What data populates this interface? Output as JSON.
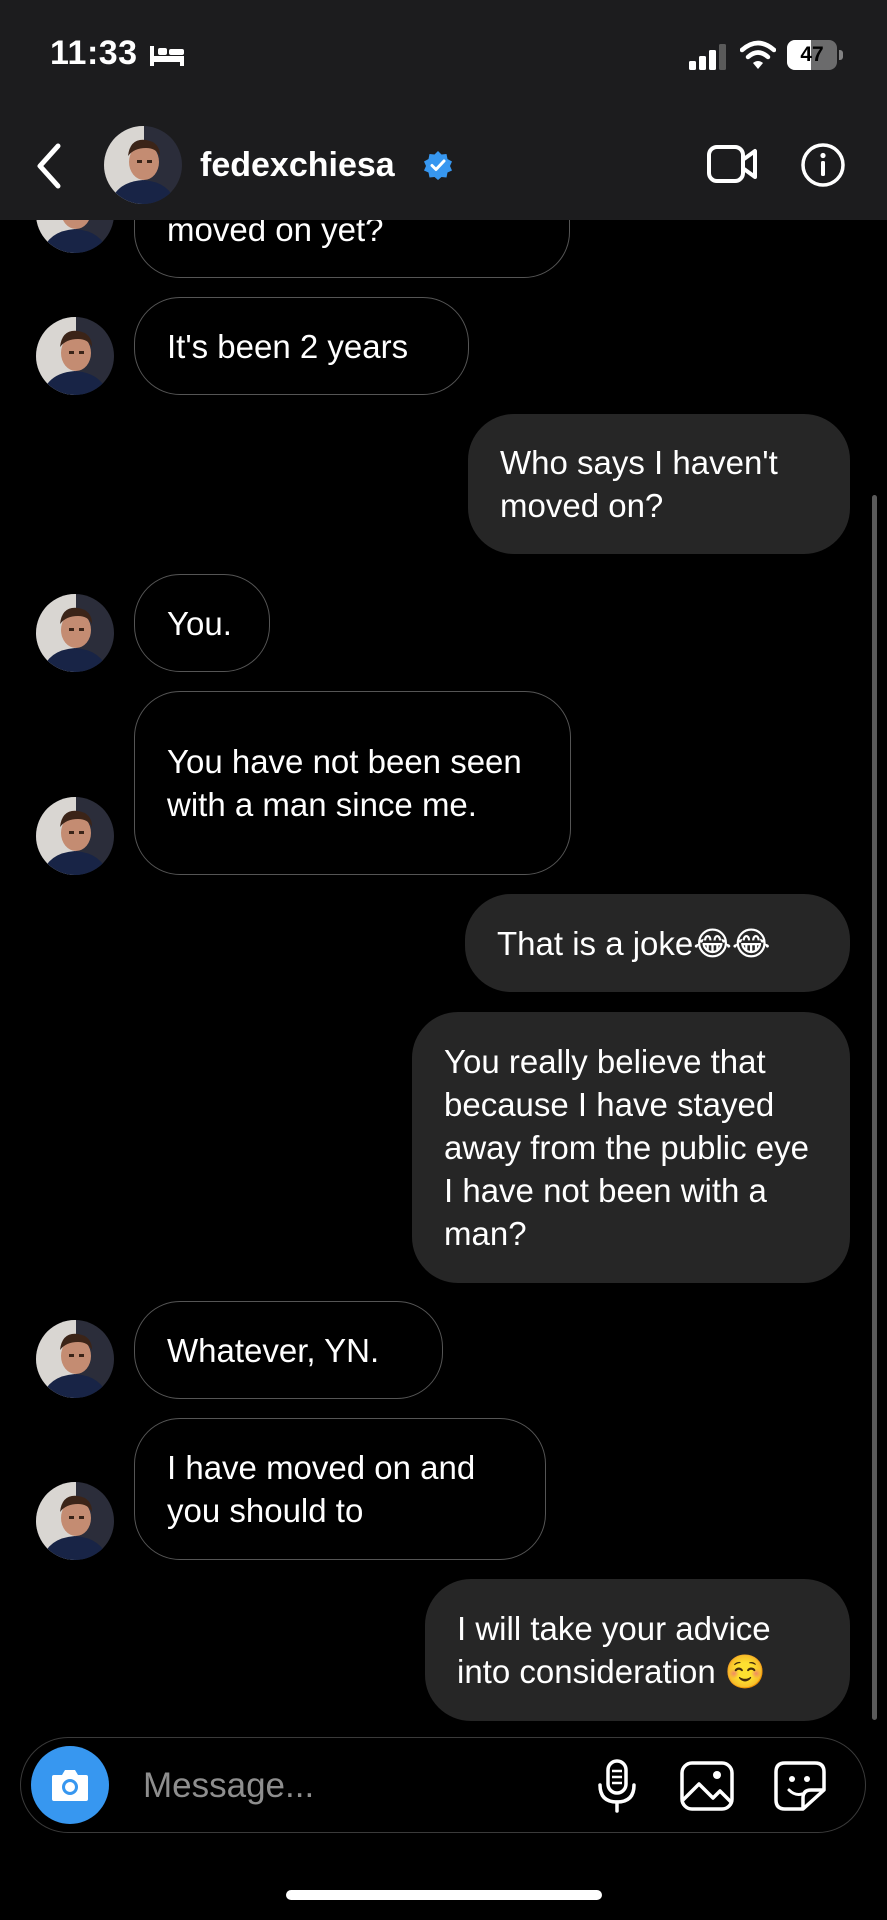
{
  "status_bar": {
    "time": "11:33",
    "battery": "47",
    "battery_level": 0.47
  },
  "header": {
    "username": "fedexchiesa",
    "verified": true
  },
  "messages": [
    {
      "direction": "incoming",
      "text": "moved on yet?",
      "avatar": true
    },
    {
      "direction": "incoming",
      "text": "It's been 2 years",
      "avatar": true
    },
    {
      "direction": "outgoing",
      "text": "Who says I haven't moved on?"
    },
    {
      "direction": "incoming",
      "text": "You.",
      "avatar": true
    },
    {
      "direction": "incoming",
      "text": "You have not been seen with a man since me.",
      "avatar": true
    },
    {
      "direction": "outgoing",
      "text": "That is a joke😂😂"
    },
    {
      "direction": "outgoing",
      "text": "You really believe that because I have stayed away from the public eye I have not been with a man?"
    },
    {
      "direction": "incoming",
      "text": "Whatever, YN.",
      "avatar": true
    },
    {
      "direction": "incoming",
      "text": "I have moved on and you should to",
      "avatar": true
    },
    {
      "direction": "outgoing",
      "text": "I will take your advice into consideration ☺️"
    }
  ],
  "composer": {
    "placeholder": "Message..."
  },
  "colors": {
    "accent": "#3797f0",
    "outgoing_bubble": "#262626",
    "incoming_border": "#555555",
    "header_bg": "#1c1c1e"
  },
  "icons": [
    "bed-icon",
    "signal-icon",
    "wifi-icon",
    "back-icon",
    "verified-icon",
    "video-call-icon",
    "info-icon",
    "camera-icon",
    "microphone-icon",
    "gallery-icon",
    "sticker-icon"
  ]
}
